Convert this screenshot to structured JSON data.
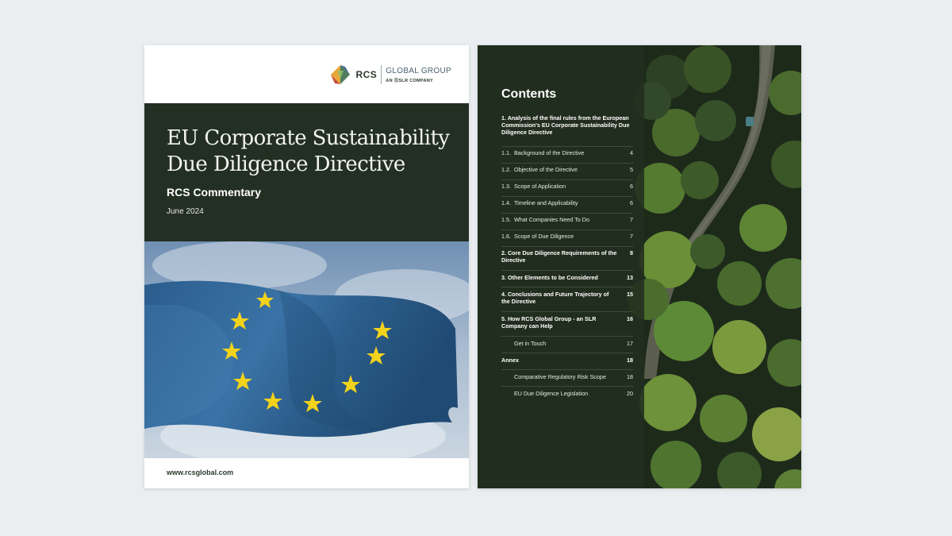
{
  "cover": {
    "logo": {
      "brand": "RCS",
      "group": "GLOBAL GROUP",
      "tagline": "AN ⓈSLR COMPANY"
    },
    "title_line1": "EU Corporate Sustainability",
    "title_line2": "Due Diligence Directive",
    "subtitle": "RCS Commentary",
    "date": "June 2024",
    "url": "www.rcsglobal.com"
  },
  "toc": {
    "heading": "Contents",
    "entries": [
      {
        "num": "",
        "label": "1. Analysis of the final rules from the European Commission's EU Corporate Sustainability Due Diligence Directive",
        "page": "",
        "bold": true
      },
      {
        "num": "1.1.",
        "label": "Background of the Directive",
        "page": "4",
        "bold": false
      },
      {
        "num": "1.2.",
        "label": "Objective of the Directive",
        "page": "5",
        "bold": false
      },
      {
        "num": "1.3.",
        "label": "Scope of Application",
        "page": "6",
        "bold": false
      },
      {
        "num": "1.4.",
        "label": "Timeline and Applicability",
        "page": "6",
        "bold": false
      },
      {
        "num": "1.5.",
        "label": "What Companies Need To Do",
        "page": "7",
        "bold": false
      },
      {
        "num": "1.6.",
        "label": "Scope of Due Diligence",
        "page": "7",
        "bold": false
      },
      {
        "num": "",
        "label": "2. Core Due Diligence Requirements of the Directive",
        "page": "8",
        "bold": true
      },
      {
        "num": "",
        "label": "3. Other Elements to be Considered",
        "page": "13",
        "bold": true
      },
      {
        "num": "",
        "label": "4. Conclusions and Future Trajectory of the Directive",
        "page": "15",
        "bold": true
      },
      {
        "num": "",
        "label": "5. How RCS Global Group - an SLR Company can Help",
        "page": "16",
        "bold": true
      },
      {
        "num": "",
        "label": "Get in Touch",
        "page": "17",
        "bold": false,
        "indent": true
      },
      {
        "num": "",
        "label": "Annex",
        "page": "18",
        "bold": true
      },
      {
        "num": "",
        "label": "Comparative Regulatory Risk Scope",
        "page": "18",
        "bold": false,
        "indent": true
      },
      {
        "num": "",
        "label": "EU Due Diligence Legislation",
        "page": "20",
        "bold": false,
        "indent": true
      }
    ]
  },
  "colors": {
    "cover_band": "#232f22",
    "flag_blue": "#2f5f8f",
    "star_yellow": "#f2d21b",
    "forest_dark": "#1f2a1c"
  }
}
